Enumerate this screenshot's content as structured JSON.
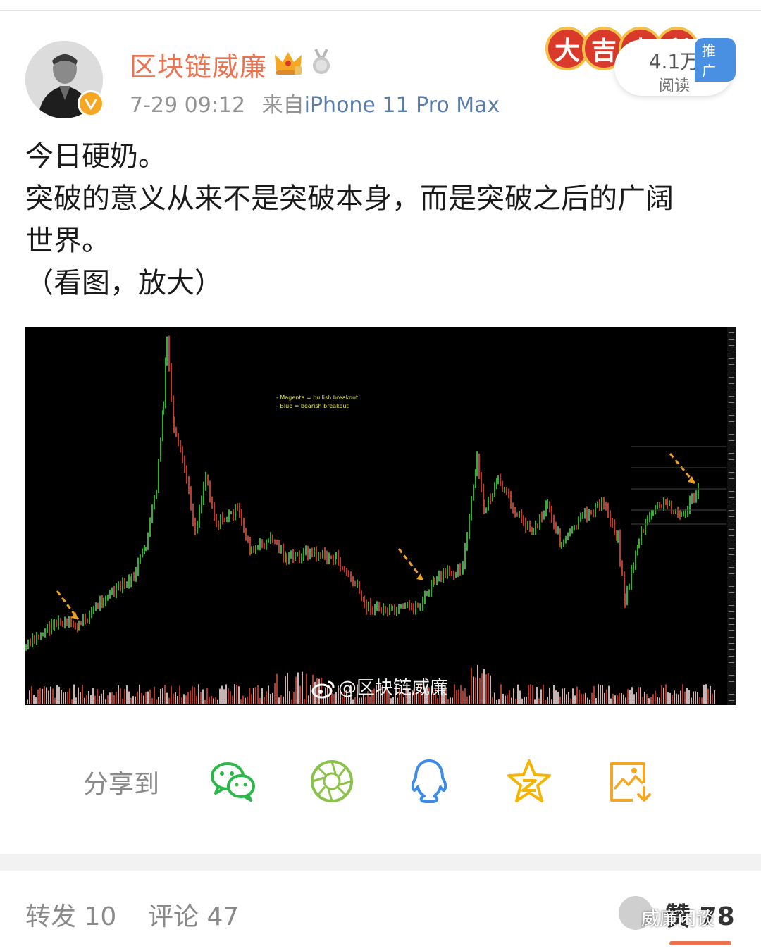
{
  "header": {
    "username": "区块链威廉",
    "time": "7-29 09:12",
    "source_prefix": "来自",
    "source": "iPhone 11 Pro Max"
  },
  "promo": {
    "badge_chars": [
      "大",
      "吉",
      "大",
      "利"
    ],
    "reads": "4.1万",
    "reads_label": "阅读",
    "tag": "推广"
  },
  "post": {
    "lines": [
      "今日硬奶。",
      "突破的意义从来不是突破本身，而是突破之后的广阔",
      "世界。",
      "（看图，放大）"
    ]
  },
  "chart_data": {
    "type": "line",
    "legend": [
      "- Magenta = bullish breakout",
      "- Blue = bearish breakout"
    ],
    "watermark": "@区块链威廉",
    "colors": {
      "background": "#000000",
      "up": "#3bbf3a",
      "down": "#d0402f",
      "arrow": "#f0a020"
    }
  },
  "share": {
    "label": "分享到",
    "items": [
      {
        "name": "wechat-icon",
        "color": "#2bb84a"
      },
      {
        "name": "moments-icon",
        "color": "#8bc34a"
      },
      {
        "name": "qq-icon",
        "color": "#3d8be8"
      },
      {
        "name": "favorite-star-icon",
        "color": "#f5b400"
      },
      {
        "name": "save-image-icon",
        "color": "#f5a623"
      }
    ]
  },
  "footer": {
    "repost": "转发 10",
    "comment": "评论 47",
    "like_prefix": "赞",
    "like_count": "78",
    "overlay_watermark": "威廉闲谈"
  }
}
